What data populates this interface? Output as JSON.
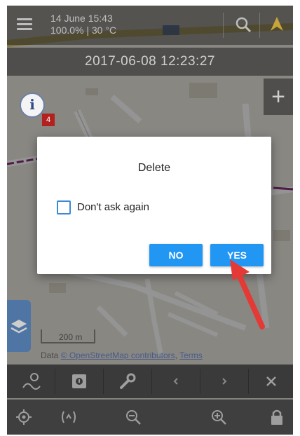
{
  "status": {
    "date_time": "14 June 15:43",
    "battery_temp": "100.0% | 30 °C"
  },
  "track_time": "2017-06-08 12:23:27",
  "map": {
    "plus_label": "+",
    "info_glyph": "i",
    "badge_count": "4",
    "scale_label": "200 m",
    "attribution_prefix": "Data ",
    "attribution_link": "© OpenStreetMap contributors",
    "attribution_sep": ", ",
    "attribution_terms": "Terms"
  },
  "dialog": {
    "title": "Delete",
    "checkbox_label": "Don't ask again",
    "no_label": "NO",
    "yes_label": "YES"
  },
  "toolbar_bottom_1": {
    "icons": [
      "route-planner-icon",
      "info-square-icon",
      "wrench-icon",
      "chevron-left-icon",
      "chevron-right-icon",
      "close-icon"
    ]
  },
  "toolbar_bottom_2": {
    "icons": [
      "gps-target-icon",
      "rotate-icon",
      "zoom-out-icon",
      "zoom-in-icon",
      "lock-icon"
    ]
  },
  "colors": {
    "accent": "#2196f3",
    "annotation_arrow": "#e53935",
    "badge": "#b32020",
    "layers_button": "#3b6fb0"
  }
}
